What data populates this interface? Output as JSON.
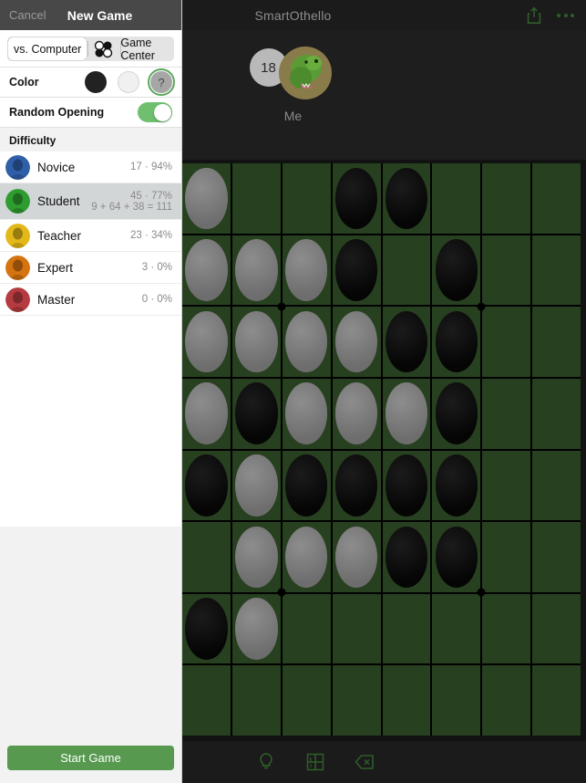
{
  "sidebar": {
    "nav": {
      "cancel_label": "Cancel",
      "title": "New Game"
    },
    "segmented": {
      "options": [
        "vs. Computer",
        "two-players-icon",
        "Game Center"
      ],
      "selected": "vs. Computer",
      "icon_name": "two-players-discs-icon"
    },
    "color": {
      "label": "Color",
      "options": [
        {
          "name": "black",
          "glyph": ""
        },
        {
          "name": "white",
          "glyph": ""
        },
        {
          "name": "random",
          "glyph": "?"
        }
      ],
      "selected": "random",
      "selection_color": "#5aa85a"
    },
    "random_opening": {
      "label": "Random Opening",
      "value": "on",
      "on_color": "#6fbf6f"
    },
    "difficulty": {
      "header": "Difficulty",
      "selected": "Student",
      "items": [
        {
          "label": "Novice",
          "stats": "17 · 94%",
          "detail": "",
          "avatar_color": "#2f5fa8"
        },
        {
          "label": "Student",
          "stats": "45 · 77%",
          "detail": "9 + 64 + 38 = 111",
          "avatar_color": "#2f9c2f"
        },
        {
          "label": "Teacher",
          "stats": "23 · 34%",
          "detail": "",
          "avatar_color": "#e3b91a"
        },
        {
          "label": "Expert",
          "stats": "3 · 0%",
          "detail": "",
          "avatar_color": "#d4730f"
        },
        {
          "label": "Master",
          "stats": "0 · 0%",
          "detail": "",
          "avatar_color": "#b53b40"
        }
      ]
    },
    "start_button": {
      "label": "Start Game",
      "color": "#56994f"
    }
  },
  "game": {
    "title": "SmartOthello",
    "topbar_actions": [
      {
        "name": "share-icon",
        "color": "#2e5c28"
      },
      {
        "name": "more-options-icon",
        "color": "#2e5c28"
      }
    ],
    "player": {
      "score": "18",
      "name": "Me",
      "avatar_name": "dinosaur-avatar"
    },
    "toolbar": [
      {
        "name": "hint-lightbulb-icon",
        "color": "#2e5c28"
      },
      {
        "name": "board-numbers-icon",
        "color": "#2e5c28"
      },
      {
        "name": "undo-delete-icon",
        "color": "#2e5c28"
      }
    ],
    "board": {
      "size": 8,
      "cell_color": "#27401f",
      "line_color": "#000000",
      "black_color": "#0a0a0a",
      "white_color": "#7d7d7d",
      "star_points": [
        [
          2,
          2
        ],
        [
          2,
          6
        ],
        [
          6,
          2
        ],
        [
          6,
          6
        ]
      ],
      "rows": [
        [
          "white",
          "empty",
          "empty",
          "black",
          "black",
          "empty",
          "empty",
          "empty"
        ],
        [
          "white",
          "white",
          "white",
          "black",
          "empty",
          "black",
          "empty",
          "empty"
        ],
        [
          "white",
          "white",
          "white",
          "white",
          "black",
          "black",
          "empty",
          "empty"
        ],
        [
          "white",
          "black",
          "white",
          "white",
          "white",
          "black",
          "empty",
          "empty"
        ],
        [
          "black",
          "white",
          "black",
          "black",
          "black",
          "black",
          "empty",
          "empty"
        ],
        [
          "empty",
          "white",
          "white",
          "white",
          "black",
          "black",
          "empty",
          "empty"
        ],
        [
          "black",
          "white",
          "empty",
          "empty",
          "empty",
          "empty",
          "empty",
          "empty"
        ],
        [
          "empty",
          "empty",
          "empty",
          "empty",
          "empty",
          "empty",
          "empty",
          "empty"
        ]
      ]
    }
  }
}
